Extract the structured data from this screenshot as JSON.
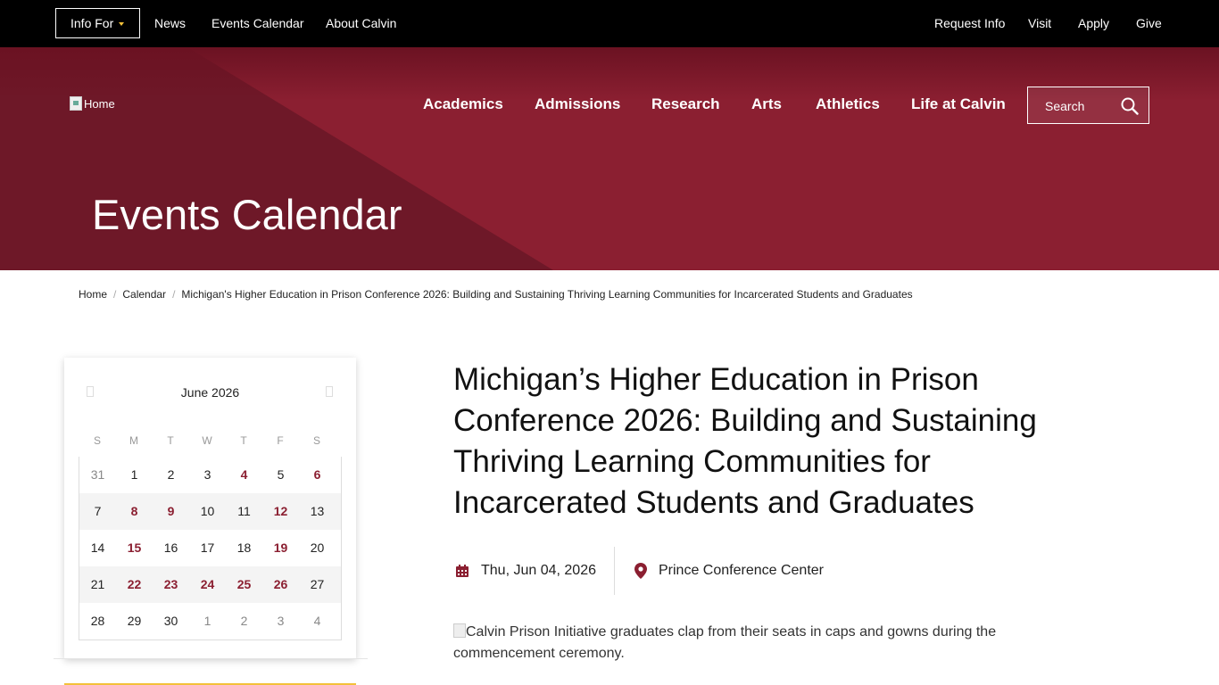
{
  "utility": {
    "info_for": "Info For",
    "links": [
      "News",
      "Events Calendar",
      "About Calvin"
    ],
    "right_links": [
      "Request Info",
      "Visit",
      "Apply",
      "Give"
    ]
  },
  "header": {
    "logo_alt": "Home",
    "nav": [
      "Academics",
      "Admissions",
      "Research",
      "Arts",
      "Athletics",
      "Life at Calvin"
    ],
    "search_placeholder": "Search"
  },
  "hero": {
    "title": "Events Calendar"
  },
  "breadcrumb": {
    "items": [
      "Home",
      "Calendar",
      "Michigan's Higher Education in Prison Conference 2026: Building and Sustaining Thriving Learning Communities for Incarcerated Students and Graduates"
    ]
  },
  "calendar": {
    "month": "June 2026",
    "weekdays": [
      "S",
      "M",
      "T",
      "W",
      "T",
      "F",
      "S"
    ],
    "weeks": [
      [
        "31",
        "1",
        "2",
        "3",
        "4",
        "5",
        "6"
      ],
      [
        "7",
        "8",
        "9",
        "10",
        "11",
        "12",
        "13"
      ],
      [
        "14",
        "15",
        "16",
        "17",
        "18",
        "19",
        "20"
      ],
      [
        "21",
        "22",
        "23",
        "24",
        "25",
        "26",
        "27"
      ],
      [
        "28",
        "29",
        "30",
        "1",
        "2",
        "3",
        "4"
      ]
    ]
  },
  "event": {
    "title": "Michigan’s Higher Education in Prison Conference 2026: Building and Sustaining Thriving Learning Communities for Incarcerated Students and Graduates",
    "date": "Thu, Jun 04, 2026",
    "location": "Prince Conference Center",
    "image_alt": "Calvin Prison Initiative graduates clap from their seats in caps and gowns during the commencement ceremony."
  },
  "colors": {
    "brand": "#8b1f31",
    "accent": "#f3c13a",
    "topbar": "#000000"
  },
  "icons": {
    "search": "search-icon",
    "date": "calendar-icon",
    "location": "map-pin-icon"
  }
}
